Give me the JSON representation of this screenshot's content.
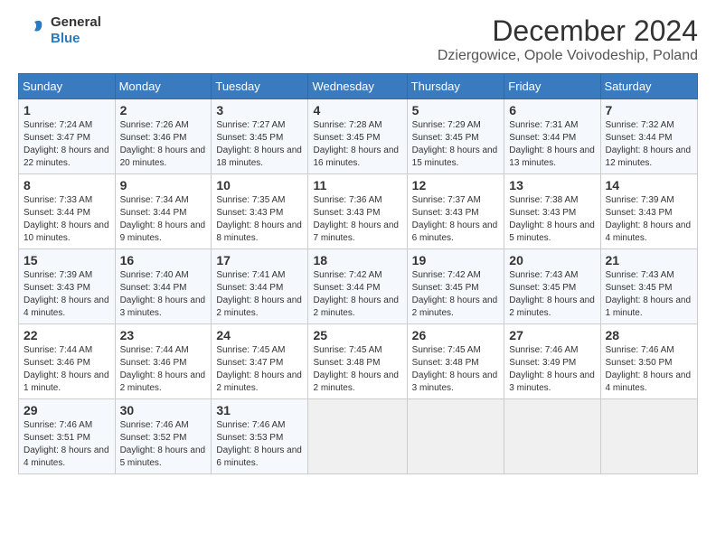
{
  "logo": {
    "general": "General",
    "blue": "Blue"
  },
  "title": "December 2024",
  "subtitle": "Dziergowice, Opole Voivodeship, Poland",
  "headers": [
    "Sunday",
    "Monday",
    "Tuesday",
    "Wednesday",
    "Thursday",
    "Friday",
    "Saturday"
  ],
  "weeks": [
    [
      {
        "day": "1",
        "sunrise": "Sunrise: 7:24 AM",
        "sunset": "Sunset: 3:47 PM",
        "daylight": "Daylight: 8 hours and 22 minutes."
      },
      {
        "day": "2",
        "sunrise": "Sunrise: 7:26 AM",
        "sunset": "Sunset: 3:46 PM",
        "daylight": "Daylight: 8 hours and 20 minutes."
      },
      {
        "day": "3",
        "sunrise": "Sunrise: 7:27 AM",
        "sunset": "Sunset: 3:45 PM",
        "daylight": "Daylight: 8 hours and 18 minutes."
      },
      {
        "day": "4",
        "sunrise": "Sunrise: 7:28 AM",
        "sunset": "Sunset: 3:45 PM",
        "daylight": "Daylight: 8 hours and 16 minutes."
      },
      {
        "day": "5",
        "sunrise": "Sunrise: 7:29 AM",
        "sunset": "Sunset: 3:45 PM",
        "daylight": "Daylight: 8 hours and 15 minutes."
      },
      {
        "day": "6",
        "sunrise": "Sunrise: 7:31 AM",
        "sunset": "Sunset: 3:44 PM",
        "daylight": "Daylight: 8 hours and 13 minutes."
      },
      {
        "day": "7",
        "sunrise": "Sunrise: 7:32 AM",
        "sunset": "Sunset: 3:44 PM",
        "daylight": "Daylight: 8 hours and 12 minutes."
      }
    ],
    [
      {
        "day": "8",
        "sunrise": "Sunrise: 7:33 AM",
        "sunset": "Sunset: 3:44 PM",
        "daylight": "Daylight: 8 hours and 10 minutes."
      },
      {
        "day": "9",
        "sunrise": "Sunrise: 7:34 AM",
        "sunset": "Sunset: 3:44 PM",
        "daylight": "Daylight: 8 hours and 9 minutes."
      },
      {
        "day": "10",
        "sunrise": "Sunrise: 7:35 AM",
        "sunset": "Sunset: 3:43 PM",
        "daylight": "Daylight: 8 hours and 8 minutes."
      },
      {
        "day": "11",
        "sunrise": "Sunrise: 7:36 AM",
        "sunset": "Sunset: 3:43 PM",
        "daylight": "Daylight: 8 hours and 7 minutes."
      },
      {
        "day": "12",
        "sunrise": "Sunrise: 7:37 AM",
        "sunset": "Sunset: 3:43 PM",
        "daylight": "Daylight: 8 hours and 6 minutes."
      },
      {
        "day": "13",
        "sunrise": "Sunrise: 7:38 AM",
        "sunset": "Sunset: 3:43 PM",
        "daylight": "Daylight: 8 hours and 5 minutes."
      },
      {
        "day": "14",
        "sunrise": "Sunrise: 7:39 AM",
        "sunset": "Sunset: 3:43 PM",
        "daylight": "Daylight: 8 hours and 4 minutes."
      }
    ],
    [
      {
        "day": "15",
        "sunrise": "Sunrise: 7:39 AM",
        "sunset": "Sunset: 3:43 PM",
        "daylight": "Daylight: 8 hours and 4 minutes."
      },
      {
        "day": "16",
        "sunrise": "Sunrise: 7:40 AM",
        "sunset": "Sunset: 3:44 PM",
        "daylight": "Daylight: 8 hours and 3 minutes."
      },
      {
        "day": "17",
        "sunrise": "Sunrise: 7:41 AM",
        "sunset": "Sunset: 3:44 PM",
        "daylight": "Daylight: 8 hours and 2 minutes."
      },
      {
        "day": "18",
        "sunrise": "Sunrise: 7:42 AM",
        "sunset": "Sunset: 3:44 PM",
        "daylight": "Daylight: 8 hours and 2 minutes."
      },
      {
        "day": "19",
        "sunrise": "Sunrise: 7:42 AM",
        "sunset": "Sunset: 3:45 PM",
        "daylight": "Daylight: 8 hours and 2 minutes."
      },
      {
        "day": "20",
        "sunrise": "Sunrise: 7:43 AM",
        "sunset": "Sunset: 3:45 PM",
        "daylight": "Daylight: 8 hours and 2 minutes."
      },
      {
        "day": "21",
        "sunrise": "Sunrise: 7:43 AM",
        "sunset": "Sunset: 3:45 PM",
        "daylight": "Daylight: 8 hours and 1 minute."
      }
    ],
    [
      {
        "day": "22",
        "sunrise": "Sunrise: 7:44 AM",
        "sunset": "Sunset: 3:46 PM",
        "daylight": "Daylight: 8 hours and 1 minute."
      },
      {
        "day": "23",
        "sunrise": "Sunrise: 7:44 AM",
        "sunset": "Sunset: 3:46 PM",
        "daylight": "Daylight: 8 hours and 2 minutes."
      },
      {
        "day": "24",
        "sunrise": "Sunrise: 7:45 AM",
        "sunset": "Sunset: 3:47 PM",
        "daylight": "Daylight: 8 hours and 2 minutes."
      },
      {
        "day": "25",
        "sunrise": "Sunrise: 7:45 AM",
        "sunset": "Sunset: 3:48 PM",
        "daylight": "Daylight: 8 hours and 2 minutes."
      },
      {
        "day": "26",
        "sunrise": "Sunrise: 7:45 AM",
        "sunset": "Sunset: 3:48 PM",
        "daylight": "Daylight: 8 hours and 3 minutes."
      },
      {
        "day": "27",
        "sunrise": "Sunrise: 7:46 AM",
        "sunset": "Sunset: 3:49 PM",
        "daylight": "Daylight: 8 hours and 3 minutes."
      },
      {
        "day": "28",
        "sunrise": "Sunrise: 7:46 AM",
        "sunset": "Sunset: 3:50 PM",
        "daylight": "Daylight: 8 hours and 4 minutes."
      }
    ],
    [
      {
        "day": "29",
        "sunrise": "Sunrise: 7:46 AM",
        "sunset": "Sunset: 3:51 PM",
        "daylight": "Daylight: 8 hours and 4 minutes."
      },
      {
        "day": "30",
        "sunrise": "Sunrise: 7:46 AM",
        "sunset": "Sunset: 3:52 PM",
        "daylight": "Daylight: 8 hours and 5 minutes."
      },
      {
        "day": "31",
        "sunrise": "Sunrise: 7:46 AM",
        "sunset": "Sunset: 3:53 PM",
        "daylight": "Daylight: 8 hours and 6 minutes."
      },
      null,
      null,
      null,
      null
    ]
  ]
}
